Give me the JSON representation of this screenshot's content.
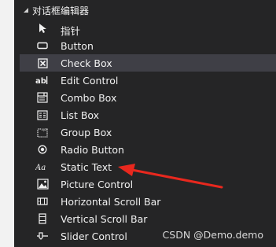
{
  "toolbox": {
    "group_title": "对话框编辑器",
    "items": [
      {
        "label": "指针",
        "icon": "pointer-icon"
      },
      {
        "label": "Button",
        "icon": "button-icon"
      },
      {
        "label": "Check Box",
        "icon": "checkbox-icon",
        "selected": true
      },
      {
        "label": "Edit Control",
        "icon": "edit-control-icon"
      },
      {
        "label": "Combo Box",
        "icon": "combo-box-icon"
      },
      {
        "label": "List Box",
        "icon": "list-box-icon"
      },
      {
        "label": "Group Box",
        "icon": "group-box-icon"
      },
      {
        "label": "Radio Button",
        "icon": "radio-button-icon"
      },
      {
        "label": "Static Text",
        "icon": "static-text-icon"
      },
      {
        "label": "Picture Control",
        "icon": "picture-control-icon"
      },
      {
        "label": "Horizontal Scroll Bar",
        "icon": "horizontal-scrollbar-icon"
      },
      {
        "label": "Vertical Scroll Bar",
        "icon": "vertical-scrollbar-icon"
      },
      {
        "label": "Slider Control",
        "icon": "slider-control-icon"
      }
    ]
  },
  "watermark": "CSDN @Demo.demo",
  "colors": {
    "panel_bg": "#252526",
    "selected_bg": "#3f3f46",
    "text": "#f1f1f1",
    "annotation_arrow": "#e8281e"
  }
}
